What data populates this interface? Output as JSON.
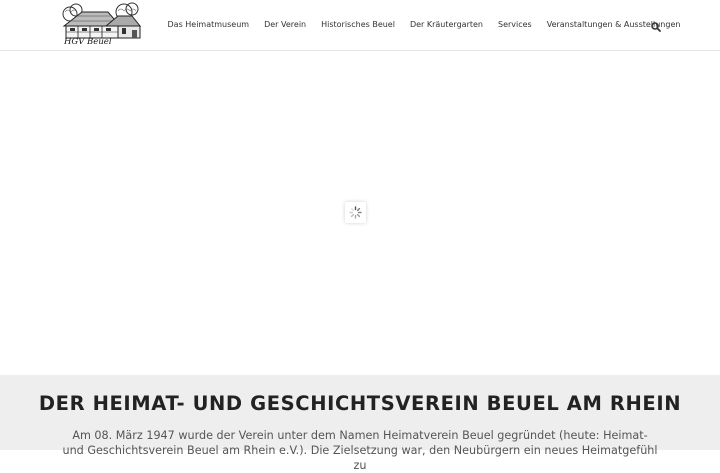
{
  "header": {
    "logo_text": "HGV Beuel",
    "nav": [
      {
        "label": "Das Heimatmuseum"
      },
      {
        "label": "Der Verein"
      },
      {
        "label": "Historisches Beuel"
      },
      {
        "label": "Der Kräutergarten"
      },
      {
        "label": "Services"
      },
      {
        "label": "Veranstaltungen & Ausstellungen"
      }
    ],
    "search_icon": "search-icon"
  },
  "hero": {
    "spinner_icon": "loading-spinner-icon"
  },
  "intro": {
    "title": "DER HEIMAT- UND GESCHICHTSVEREIN BEUEL AM RHEIN",
    "text": "Am 08. März 1947 wurde der Verein unter dem Namen Heimatverein Beuel gegründet (heute: Heimat- und Geschichtsverein Beuel am Rhein e.V.). Die Zielsetzung war, den Neubürgern ein neues Heimatgefühl zu"
  },
  "colors": {
    "header_bg": "#ffffff",
    "intro_bg": "#eeeeee",
    "title": "#222222",
    "text": "#555555"
  }
}
